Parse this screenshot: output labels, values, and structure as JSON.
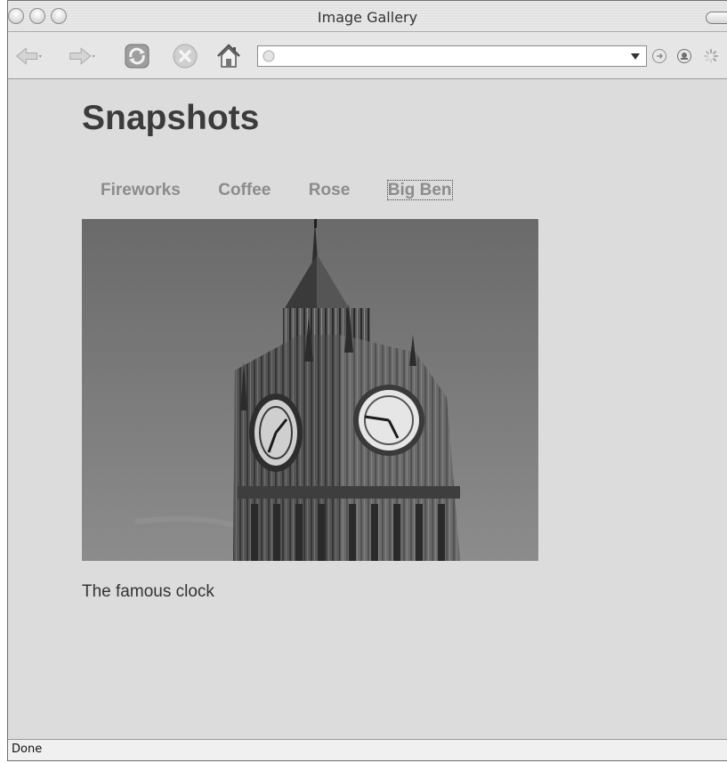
{
  "window": {
    "title": "Image Gallery"
  },
  "toolbar": {
    "back_icon": "back-arrow-icon",
    "forward_icon": "forward-arrow-icon",
    "reload_icon": "reload-icon",
    "stop_icon": "stop-icon",
    "home_icon": "home-icon",
    "url_value": "",
    "url_placeholder": ""
  },
  "page": {
    "heading": "Snapshots",
    "nav": [
      {
        "label": "Fireworks",
        "active": false
      },
      {
        "label": "Coffee",
        "active": false
      },
      {
        "label": "Rose",
        "active": false
      },
      {
        "label": "Big Ben",
        "active": true
      }
    ],
    "image_subject": "Big Ben clock tower",
    "caption": "The famous clock"
  },
  "status": {
    "text": "Done"
  },
  "colors": {
    "page_background": "#dcdcdc",
    "heading": "#3c3c3c",
    "nav_link": "#8c8c8c",
    "caption": "#333333"
  }
}
